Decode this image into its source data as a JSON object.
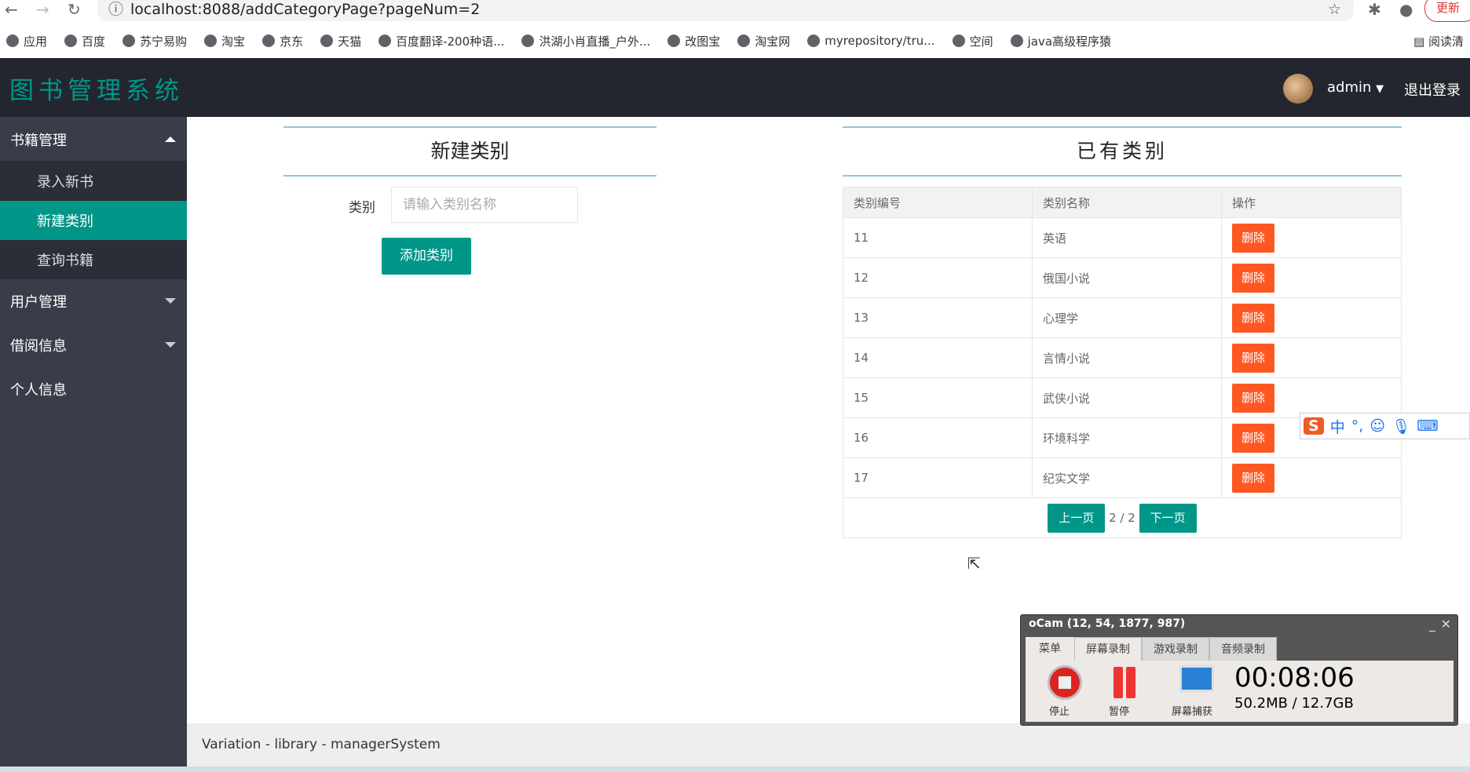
{
  "browser": {
    "url": "localhost:8088/addCategoryPage?pageNum=2",
    "update_label": "更新",
    "reading_list": "阅读清",
    "bookmarks": [
      "应用",
      "百度",
      "苏宁易购",
      "淘宝",
      "京东",
      "天猫",
      "百度翻译-200种语...",
      "洪湖小肖直播_户外...",
      "改图宝",
      "淘宝网",
      "myrepository/tru...",
      "空间",
      "java高级程序猿"
    ]
  },
  "header": {
    "logo": "图书管理系统",
    "user": "admin",
    "logout": "退出登录"
  },
  "sidebar": {
    "items": [
      {
        "label": "书籍管理"
      },
      {
        "label": "录入新书"
      },
      {
        "label": "新建类别"
      },
      {
        "label": "查询书籍"
      },
      {
        "label": "用户管理"
      },
      {
        "label": "借阅信息"
      },
      {
        "label": "个人信息"
      }
    ]
  },
  "form": {
    "title": "新建类别",
    "label": "类别",
    "placeholder": "请输入类别名称",
    "submit": "添加类别"
  },
  "list": {
    "title": "已有类别",
    "columns": [
      "类别编号",
      "类别名称",
      "操作"
    ],
    "rows": [
      {
        "id": "11",
        "name": "英语"
      },
      {
        "id": "12",
        "name": "俄国小说"
      },
      {
        "id": "13",
        "name": "心理学"
      },
      {
        "id": "14",
        "name": "言情小说"
      },
      {
        "id": "15",
        "name": "武侠小说"
      },
      {
        "id": "16",
        "name": "环境科学"
      },
      {
        "id": "17",
        "name": "纪实文学"
      }
    ],
    "delete_label": "删除",
    "prev": "上一页",
    "next": "下一页",
    "page_info": "2 / 2"
  },
  "footer": {
    "text": "Variation - library - managerSystem"
  },
  "ocam": {
    "title": "oCam (12, 54, 1877, 987)",
    "tabs": [
      "菜单",
      "屏幕录制",
      "游戏录制",
      "音频录制"
    ],
    "stop": "停止",
    "pause": "暂停",
    "capture": "屏幕捕获",
    "time": "00:08:06",
    "size": "50.2MB / 12.7GB"
  },
  "ime": {
    "mode": "中"
  }
}
